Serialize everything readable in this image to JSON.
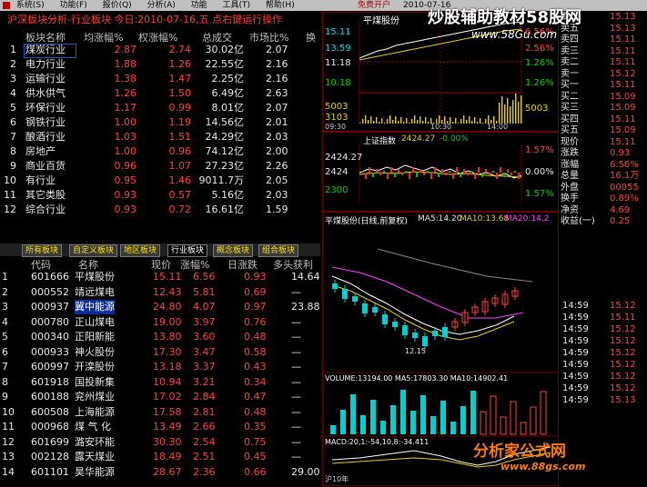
{
  "menubar": {
    "items": [
      "系统(S)",
      "功能(F)",
      "报价(Q)",
      "分析(A)",
      "功能",
      "工具(T)",
      "帮助(H)"
    ],
    "right": [
      "免费开户",
      "2010-07-16",
      "买卖"
    ]
  },
  "left_title": "沪深板块分析-行业板块  今日:2010-07-16,五  点右键运行操作",
  "sector_headers": [
    "板块名称",
    "均涨幅%",
    "权涨幅%",
    "总成交",
    "市场比%",
    "换"
  ],
  "sectors": [
    {
      "n": "1",
      "name": "煤炭行业",
      "a": "2.87",
      "b": "2.74",
      "vol": "30.02亿",
      "mkt": "2.07"
    },
    {
      "n": "2",
      "name": "电力行业",
      "a": "1.88",
      "b": "1.26",
      "vol": "22.55亿",
      "mkt": "2.16"
    },
    {
      "n": "3",
      "name": "运输行业",
      "a": "1.38",
      "b": "1.47",
      "vol": "2.25亿",
      "mkt": "2.16"
    },
    {
      "n": "4",
      "name": "供水供气",
      "a": "1.26",
      "b": "1.50",
      "vol": "6.49亿",
      "mkt": "2.63"
    },
    {
      "n": "5",
      "name": "环保行业",
      "a": "1.17",
      "b": "0.99",
      "vol": "8.01亿",
      "mkt": "2.07"
    },
    {
      "n": "6",
      "name": "钢铁行业",
      "a": "1.00",
      "b": "1.19",
      "vol": "14.56亿",
      "mkt": "2.01"
    },
    {
      "n": "7",
      "name": "酿酒行业",
      "a": "1.03",
      "b": "1.51",
      "vol": "24.29亿",
      "mkt": "2.03"
    },
    {
      "n": "8",
      "name": "房地产",
      "a": "1.00",
      "b": "0.96",
      "vol": "74.12亿",
      "mkt": "2.00"
    },
    {
      "n": "9",
      "name": "商业百货",
      "a": "0.96",
      "b": "1.07",
      "vol": "27.23亿",
      "mkt": "2.26"
    },
    {
      "n": "10",
      "name": "有行业",
      "a": "0.95",
      "b": "1.46",
      "vol": "9011.7万",
      "mkt": "2.05"
    },
    {
      "n": "11",
      "name": "其它类股",
      "a": "0.93",
      "b": "0.57",
      "vol": "5.16亿",
      "mkt": "2.03"
    },
    {
      "n": "12",
      "name": "综合行业",
      "a": "0.93",
      "b": "0.72",
      "vol": "16.61亿",
      "mkt": "1.59"
    }
  ],
  "tabs": [
    "所有板块",
    "自定义板块",
    "地区板块",
    "行业板块",
    "概念板块",
    "组合板块"
  ],
  "stock_headers": [
    "代码",
    "名称",
    "",
    "现价",
    "涨幅%",
    "日涨跌",
    "多头获利"
  ],
  "stocks": [
    {
      "n": "1",
      "code": "601666",
      "name": "平煤股份",
      "p": "15.11",
      "c": "6.56",
      "x": "0.93",
      "y": "14.64"
    },
    {
      "n": "2",
      "code": "000552",
      "name": "靖远煤电",
      "p": "12.43",
      "c": "5.81",
      "x": "0.69",
      "y": "—"
    },
    {
      "n": "3",
      "code": "000937",
      "name": "冀中能源",
      "p": "24.80",
      "c": "4.07",
      "x": "0.97",
      "y": "23.88"
    },
    {
      "n": "4",
      "code": "000780",
      "name": "正山煤电",
      "p": "19.00",
      "c": "3.97",
      "x": "0.76",
      "y": "—"
    },
    {
      "n": "5",
      "code": "000340",
      "name": "正阳新能",
      "p": "13.80",
      "c": "3.60",
      "x": "0.48",
      "y": "—"
    },
    {
      "n": "6",
      "code": "000933",
      "name": "神火股份",
      "p": "17.30",
      "c": "3.47",
      "x": "0.58",
      "y": "—"
    },
    {
      "n": "7",
      "code": "600997",
      "name": "开滦股份",
      "p": "13.18",
      "c": "3.37",
      "x": "0.43",
      "y": "—"
    },
    {
      "n": "8",
      "code": "601918",
      "name": "国投新集",
      "p": "10.94",
      "c": "3.21",
      "x": "0.34",
      "y": "—"
    },
    {
      "n": "9",
      "code": "600188",
      "name": "兖州煤业",
      "p": "17.02",
      "c": "2.84",
      "x": "0.47",
      "y": "—"
    },
    {
      "n": "10",
      "code": "600508",
      "name": "上海能源",
      "p": "17.58",
      "c": "2.81",
      "x": "0.48",
      "y": "—"
    },
    {
      "n": "11",
      "code": "000968",
      "name": "煤 气 化",
      "p": "13.49",
      "c": "2.66",
      "x": "0.35",
      "y": "—"
    },
    {
      "n": "12",
      "code": "601699",
      "name": "潞安环能",
      "p": "30.30",
      "c": "2.54",
      "x": "0.75",
      "y": "—"
    },
    {
      "n": "13",
      "code": "002128",
      "name": "露天煤业",
      "p": "18.49",
      "c": "2.51",
      "x": "0.45",
      "y": "—"
    },
    {
      "n": "14",
      "code": "601101",
      "name": "昊华能源",
      "p": "28.67",
      "c": "2.36",
      "x": "0.66",
      "y": "29.00"
    }
  ],
  "intraday": {
    "title": "平煤股份",
    "left_ticks": [
      "15.11",
      "13.59",
      "11.18",
      "10.18",
      "5003",
      "3103"
    ],
    "right_ticks": [
      "6.56%",
      "2.56%",
      "1.26%",
      "1.26%",
      "5003"
    ],
    "time_ticks": [
      "09:30",
      "10:30",
      "14:00"
    ]
  },
  "index_panel": {
    "title": "上证指数",
    "price": "2424.27",
    "change": "-0.00%",
    "ticks": [
      "2424.27",
      "2424",
      "2300"
    ],
    "right_ticks": [
      "1.57%",
      "0.00%",
      "1.57%"
    ]
  },
  "kline": {
    "title": "平煤股份(日线,前复权)",
    "ma5": "MA5:14.20",
    "ma10": "MA10:13.68",
    "ma20": "MA20:14.2",
    "low_label": "12.15",
    "vol_label": "VOLUME:13194.00 MA5:17803.30 MA10:14902.41",
    "macd_label": "MACD:20,1:-54,10,8:-34.411"
  },
  "side_panel": {
    "rows": [
      [
        "委比",
        "15.13"
      ],
      [
        "卖五",
        "15.13"
      ],
      [
        "卖四",
        "15.11"
      ],
      [
        "卖三",
        "15.11"
      ],
      [
        "卖二",
        "15.11"
      ],
      [
        "卖一",
        "15.12"
      ],
      [
        "买一",
        "15.11"
      ],
      [
        "买二",
        "15.09"
      ],
      [
        "买三",
        "15.09"
      ],
      [
        "买四",
        "15.11"
      ],
      [
        "买五",
        "15.09"
      ],
      [
        "现价",
        "15.11"
      ],
      [
        "涨跌",
        "0.93"
      ],
      [
        "涨幅",
        "6.56%"
      ],
      [
        "总量",
        "16.1万"
      ],
      [
        "外盘",
        "00055"
      ],
      [
        "换手",
        "0.89%"
      ],
      [
        "净资",
        "4.69"
      ],
      [
        "收益(一)",
        "0.25"
      ]
    ],
    "ticks": [
      [
        "14:59",
        "15.12"
      ],
      [
        "14:59",
        "15.11"
      ],
      [
        "14:59",
        "15.12"
      ],
      [
        "14:59",
        "15.12"
      ],
      [
        "14:59",
        "15.12"
      ],
      [
        "14:59",
        "15.12"
      ],
      [
        "14:59",
        "15.12"
      ],
      [
        "14:59",
        "15.12"
      ],
      [
        "14:59",
        "15.13"
      ]
    ]
  },
  "watermarks": {
    "top": "炒股辅助教材58股网",
    "top_url": "www.58Gu.com",
    "bottom": "分析家公式网",
    "bottom_url": "www.88gs.com"
  },
  "status_bar": "沪10年"
}
